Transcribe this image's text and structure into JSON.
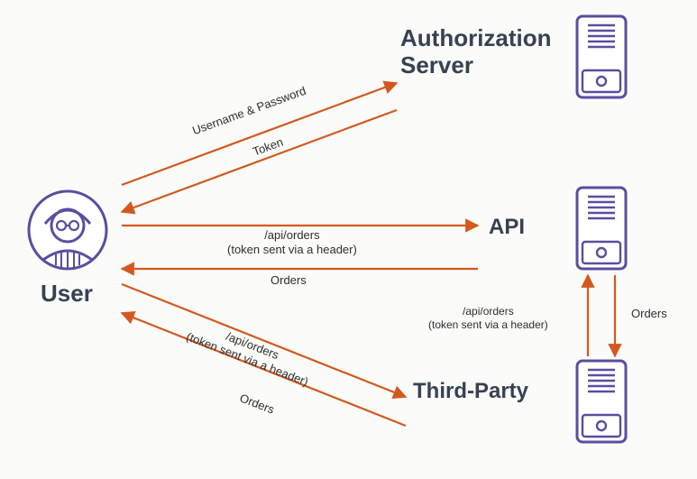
{
  "nodes": {
    "user": {
      "label": "User"
    },
    "auth": {
      "label": "Authorization\nServer"
    },
    "api": {
      "label": "API"
    },
    "third": {
      "label": "Third-Party"
    }
  },
  "edges": {
    "user_to_auth": {
      "label": "Username & Password"
    },
    "auth_to_user": {
      "label": "Token"
    },
    "user_to_api": {
      "label": "/api/orders\n(token sent via a header)"
    },
    "api_to_user": {
      "label": "Orders"
    },
    "user_to_third": {
      "label": "/api/orders\n(token sent via a header)"
    },
    "third_to_user": {
      "label": "Orders"
    },
    "third_to_api": {
      "label": "/api/orders\n(token sent via a header)"
    },
    "api_to_third": {
      "label": "Orders"
    }
  },
  "colors": {
    "arrow": "#d3591e",
    "node_stroke": "#5b4da0",
    "text": "#374151"
  }
}
